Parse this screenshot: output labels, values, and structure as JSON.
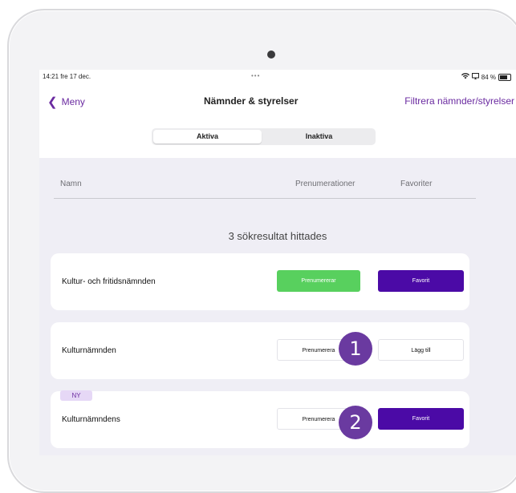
{
  "status_bar": {
    "time": "14:21  fre 17 dec.",
    "dots": "•••",
    "battery_percent": "84 %"
  },
  "nav": {
    "back_label": "Meny",
    "title": "Nämnder & styrelser",
    "filter_label": "Filtrera nämnder/styrelser"
  },
  "segments": {
    "active_label": "Aktiva",
    "inactive_label": "Inaktiva",
    "selected": "Aktiva"
  },
  "columns": {
    "name": "Namn",
    "subscriptions": "Prenumerationer",
    "favorites": "Favoriter"
  },
  "results_text": "3 sökresultat hittades",
  "rows": [
    {
      "name": "Kultur- och fritidsnämnden",
      "subscribe_label": "Prenumererar",
      "subscribe_state": "active",
      "favorite_label": "Favorit",
      "favorite_state": "active"
    },
    {
      "name": "Kulturnämnden",
      "subscribe_label": "Prenumerera",
      "subscribe_state": "inactive",
      "favorite_label": "Lägg till",
      "favorite_state": "inactive"
    },
    {
      "name": "Kulturnämndens",
      "badge": "NY",
      "subscribe_label": "Prenumerera",
      "subscribe_state": "inactive",
      "favorite_label": "Favorit",
      "favorite_state": "active"
    }
  ],
  "markers": [
    "1",
    "2"
  ],
  "colors": {
    "accent": "#6a2aa0",
    "subscribed_green": "#58d05e",
    "favorite_purple": "#4b0aa6",
    "marker_purple": "#6a3aa0"
  },
  "icons": [
    "chevron-left-icon",
    "wifi-icon",
    "screen-mirror-icon",
    "battery-icon"
  ]
}
